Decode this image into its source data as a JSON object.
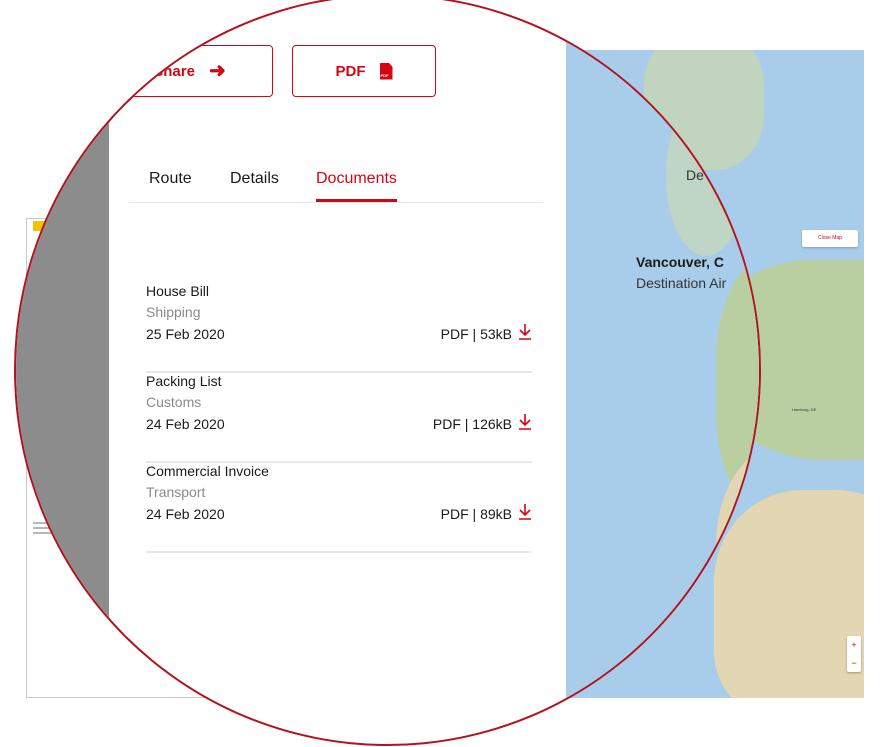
{
  "buttons": {
    "share_label": "Share",
    "pdf_label": "PDF"
  },
  "tabs": [
    {
      "label": "Route",
      "active": false
    },
    {
      "label": "Details",
      "active": false
    },
    {
      "label": "Documents",
      "active": true
    }
  ],
  "documents": [
    {
      "title": "House Bill",
      "category": "Shipping",
      "date": "25 Feb 2020",
      "meta": "PDF | 53kB"
    },
    {
      "title": "Packing List",
      "category": "Customs",
      "date": "24 Feb 2020",
      "meta": "PDF | 126kB"
    },
    {
      "title": "Commercial Invoice",
      "category": "Transport",
      "date": "24 Feb 2020",
      "meta": "PDF | 89kB"
    }
  ],
  "map": {
    "destination_city": "Vancouver, C",
    "destination_type": "Destination Air",
    "top_city": "",
    "top_type": "De",
    "close_map_label": "Close Map",
    "marker_label": "Hamburg, DE",
    "origin_label": "DE"
  },
  "colors": {
    "accent": "#d40511",
    "circle_border": "#b3121d",
    "map_water": "#a8cdea"
  }
}
